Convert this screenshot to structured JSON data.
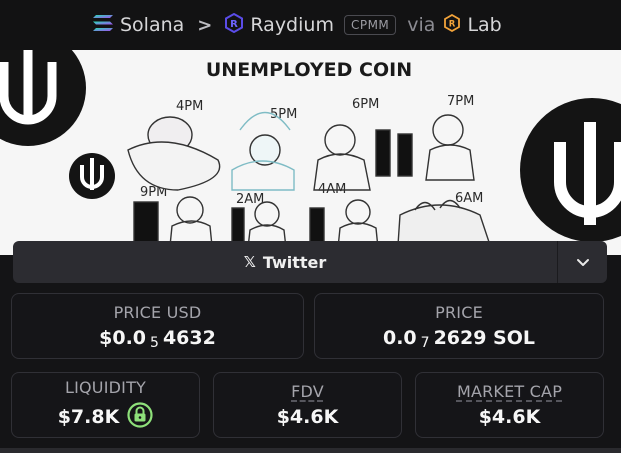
{
  "breadcrumb": {
    "chain": "Solana",
    "dex": "Raydium",
    "pool_type": "CPMM",
    "via": "via",
    "launchpad": "Lab"
  },
  "banner": {
    "title": "UNEMPLOYED COIN",
    "times_top": [
      "4PM",
      "5PM",
      "6PM",
      "7PM"
    ],
    "times_bottom": [
      "9PM",
      "2AM",
      "4AM",
      "6AM"
    ],
    "logo_letter": "U"
  },
  "twitter": {
    "label": "Twitter",
    "x_glyph": "𝕏"
  },
  "stats": {
    "price_usd": {
      "label": "PRICE USD",
      "prefix": "$0.0",
      "zeros": "5",
      "digits": "4632"
    },
    "price_sol": {
      "label": "PRICE",
      "prefix": "0.0",
      "zeros": "7",
      "digits": "2629 SOL"
    },
    "liquidity": {
      "label": "LIQUIDITY",
      "value": "$7.8K"
    },
    "fdv": {
      "label": "FDV",
      "value": "$4.6K"
    },
    "market_cap": {
      "label": "MARKET CAP",
      "value": "$4.6K"
    }
  },
  "colors": {
    "background": "#141416",
    "card_border": "#303036",
    "button_bg": "#2c2c31",
    "lock_green": "#8ee07a",
    "raydium_purple": "#5a4ce8",
    "lab_orange": "#f2a33a"
  }
}
